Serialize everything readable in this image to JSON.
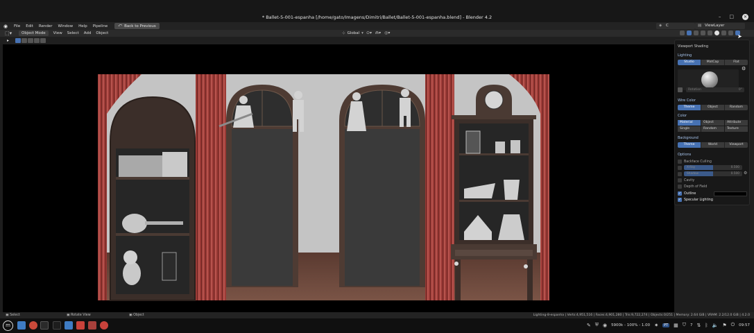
{
  "window": {
    "title": "* Ballet-5-001-espanha [/home/gato/Imagens/Dimitri/Ballet/Ballet-5-001-espanha.blend] - Blender 4.2",
    "controls": [
      "–",
      "□",
      "✕"
    ]
  },
  "topbar": {
    "menus": [
      "File",
      "Edit",
      "Render",
      "Window",
      "Help",
      "Pipeline"
    ],
    "back_button": "Back to Previous",
    "scene_name": "C",
    "view_layer": "ViewLayer"
  },
  "viewport_header": {
    "mode": "Object Mode",
    "menus": [
      "View",
      "Select",
      "Add",
      "Object"
    ],
    "orientation": "Global"
  },
  "shading_panel": {
    "title": "Viewport Shading",
    "lighting": {
      "label": "Lighting",
      "options": [
        "Studio",
        "MatCap",
        "Flat"
      ],
      "active": "Studio",
      "rotation_label": "Rotation",
      "rotation_value": "0°"
    },
    "wire_color": {
      "label": "Wire Color",
      "options": [
        "Theme",
        "Object",
        "Random"
      ],
      "active": "Theme"
    },
    "color": {
      "label": "Color",
      "options": [
        "Material",
        "Object",
        "Attribute",
        "Single",
        "Random",
        "Texture"
      ],
      "active": "Material"
    },
    "background": {
      "label": "Background",
      "options": [
        "Theme",
        "World",
        "Viewport"
      ],
      "active": "Theme"
    },
    "options": {
      "label": "Options",
      "backface": "Backface Culling",
      "xray_label": "X-Ray",
      "xray_value": "0.500",
      "xray_fill": 0.5,
      "shadow_label": "Shadow",
      "shadow_value": "0.500",
      "shadow_fill": 0.5,
      "cavity": "Cavity",
      "dof": "Depth of Field",
      "outline": "Outline",
      "specular": "Specular Lighting"
    }
  },
  "statusbar": {
    "hints": [
      "Select",
      "Rotate View",
      "Object"
    ],
    "stats": "Lighting-8-espanha | Verts:4,951,516 | Faces:4,901,280 | Tris:9,722,274 | Objects:0/251 | Memory: 2.64 GiB | VRAM: 2.2/12.0 GiB | 4.2.0"
  },
  "taskbar": {
    "display": "5900k - 100% - 1.00",
    "lang": "PT",
    "workspace": "7",
    "clock": "09:57"
  },
  "colors": {
    "accent": "#4772b3",
    "curtain": "#a8403b",
    "wall": "#bcbcbc",
    "floor": "#6b4a3d",
    "wood": "#4a3a33"
  }
}
